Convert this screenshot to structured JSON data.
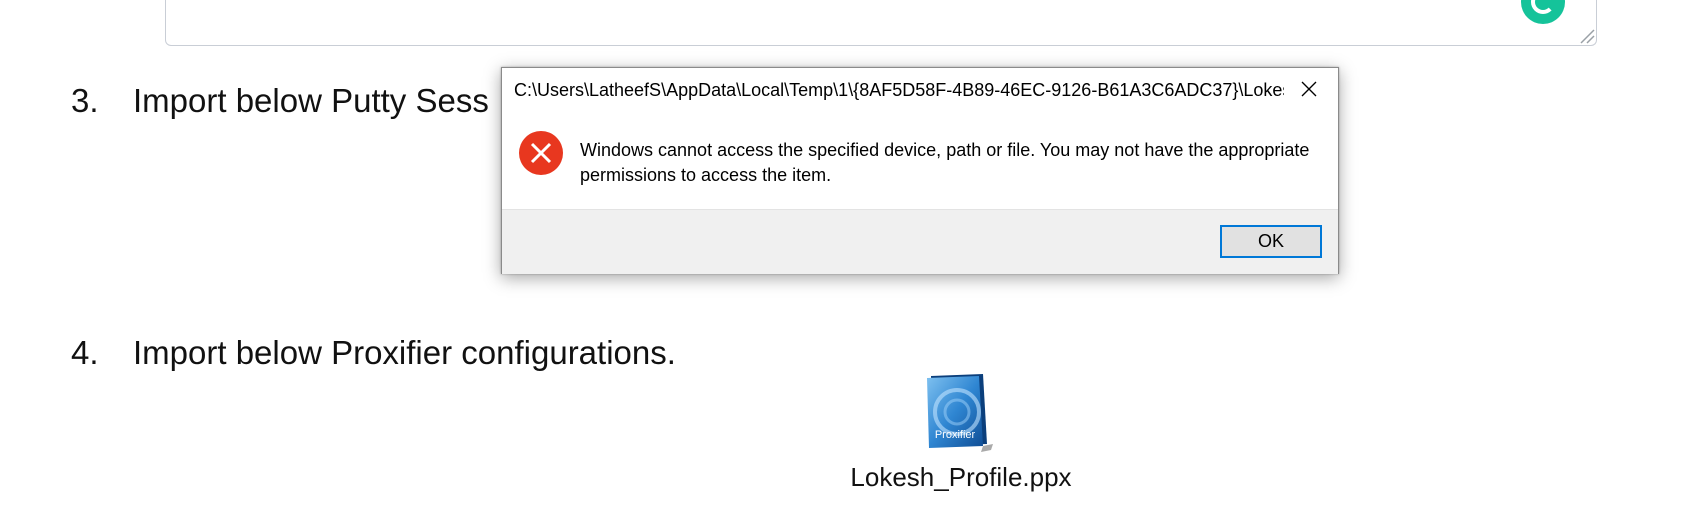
{
  "document": {
    "items": [
      {
        "number": "3.",
        "text": "Import below Putty Sess"
      },
      {
        "number": "4.",
        "text": "Import below Proxifier configurations."
      }
    ],
    "embedded_file": {
      "icon_label": "Proxifier",
      "filename": "Lokesh_Profile.ppx"
    }
  },
  "dialog": {
    "title": "C:\\Users\\LatheefS\\AppData\\Local\\Temp\\1\\{8AF5D58F-4B89-46EC-9126-B61A3C6ADC37}\\Lokes...",
    "message": "Windows cannot access the specified device, path or file. You may not have the appropriate permissions to access the item.",
    "ok_label": "OK"
  },
  "colors": {
    "accent": "#0078d7",
    "error": "#e81123",
    "grammarly": "#15c39a"
  },
  "icons": {
    "error": "error-icon",
    "close": "close-icon",
    "grammarly": "grammarly-icon",
    "file": "proxifier-file-icon"
  }
}
